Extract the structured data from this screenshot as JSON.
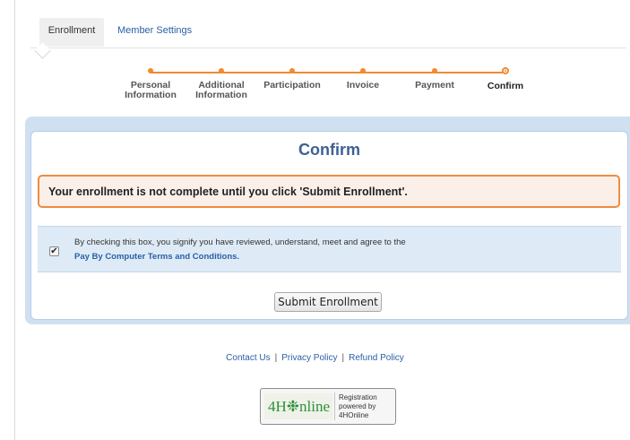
{
  "tabs": {
    "enrollment": "Enrollment",
    "member_settings": "Member Settings"
  },
  "steps": [
    {
      "line1": "Personal",
      "line2": "Information"
    },
    {
      "line1": "Additional",
      "line2": "Information"
    },
    {
      "line1": "Participation",
      "line2": ""
    },
    {
      "line1": "Invoice",
      "line2": ""
    },
    {
      "line1": "Payment",
      "line2": ""
    },
    {
      "line1": "Confirm",
      "line2": ""
    }
  ],
  "current_step": 5,
  "panel": {
    "title": "Confirm",
    "alert": "Your enrollment is not complete until you click 'Submit Enrollment'.",
    "terms_text": "By checking this box, you signify you have reviewed, understand, meet and agree to the",
    "terms_link": "Pay By Computer Terms and Conditions.",
    "terms_checked": true,
    "submit_label": "Submit Enrollment"
  },
  "footer": {
    "contact": "Contact Us",
    "privacy": "Privacy Policy",
    "refund": "Refund Policy",
    "separator": "|"
  },
  "badge": {
    "logo": "4H❉nline",
    "line1": "Registration",
    "line2": "powered by",
    "line3": "4HOnline"
  },
  "colors": {
    "accent": "#f28a30",
    "title": "#3d6193",
    "link": "#2a5fa6",
    "panel": "#cfe0f1"
  }
}
